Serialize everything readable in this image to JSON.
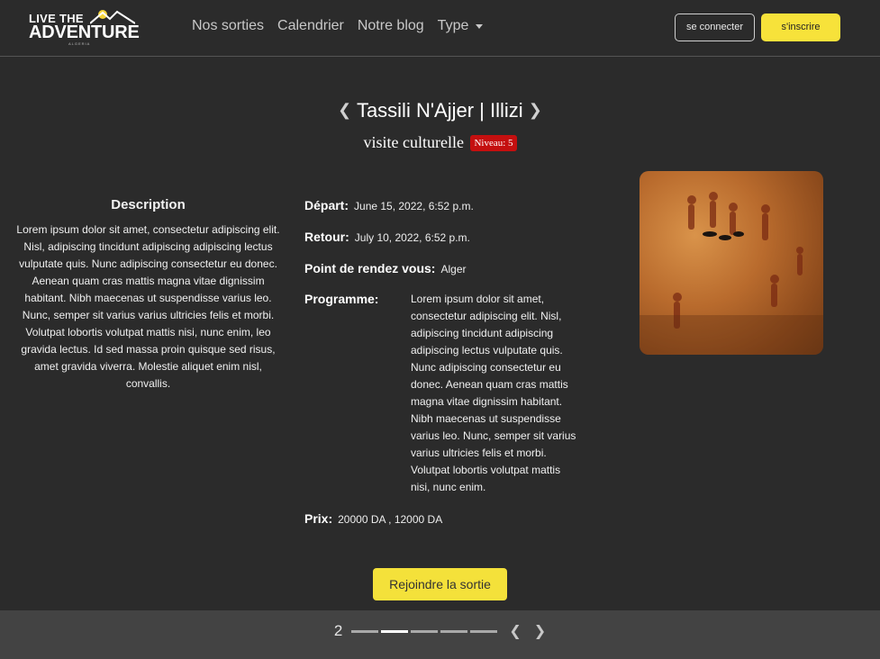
{
  "logo": {
    "line1": "LIVE THE",
    "line2": "ADVENTURE",
    "line3": "ALGERIA"
  },
  "nav": {
    "items": [
      "Nos sorties",
      "Calendrier",
      "Notre blog"
    ],
    "type_label": "Type"
  },
  "auth": {
    "login_label": "se connecter",
    "signup_label": "s'inscrire"
  },
  "trip": {
    "title": "Tassili N'Ajjer | Illizi",
    "prev_glyph": "❮",
    "next_glyph": "❯",
    "category": "visite culturelle",
    "level_label": "Niveau: 5",
    "description_title": "Description",
    "description": "Lorem ipsum dolor sit amet, consectetur adipiscing elit. Nisl, adipiscing tincidunt adipiscing adipiscing lectus vulputate quis. Nunc adipiscing consectetur eu donec. Aenean quam cras mattis magna vitae dignissim habitant. Nibh maecenas ut suspendisse varius leo. Nunc, semper sit varius varius ultricies felis et morbi. Volutpat lobortis volutpat mattis nisi, nunc enim, leo gravida lectus. Id sed massa proin quisque sed risus, amet gravida viverra. Molestie aliquet enim nisl, convallis.",
    "depart_label": "Départ:",
    "depart_value": "June 15, 2022, 6:52 p.m.",
    "retour_label": "Retour:",
    "retour_value": "July 10, 2022, 6:52 p.m.",
    "rdv_label": "Point de rendez vous:",
    "rdv_value": "Alger",
    "programme_label": "Programme:",
    "programme_value": "Lorem ipsum dolor sit amet, consectetur adipiscing elit. Nisl, adipiscing tincidunt adipiscing adipiscing lectus vulputate quis. Nunc adipiscing consectetur eu donec. Aenean quam cras mattis magna vitae dignissim habitant. Nibh maecenas ut suspendisse varius leo. Nunc, semper sit varius varius ultricies felis et morbi. Volutpat lobortis volutpat mattis nisi, nunc enim.",
    "prix_label": "Prix:",
    "prix_value": "20000 DA , 12000 DA",
    "join_label": "Rejoindre la sortie"
  },
  "pager": {
    "current": "2",
    "segments": 5,
    "active_index": 1,
    "prev_glyph": "❮",
    "next_glyph": "❯"
  },
  "colors": {
    "accent": "#f4e13a",
    "background": "#2b2b2b",
    "footer": "#434343",
    "badge": "#c40f0f"
  }
}
